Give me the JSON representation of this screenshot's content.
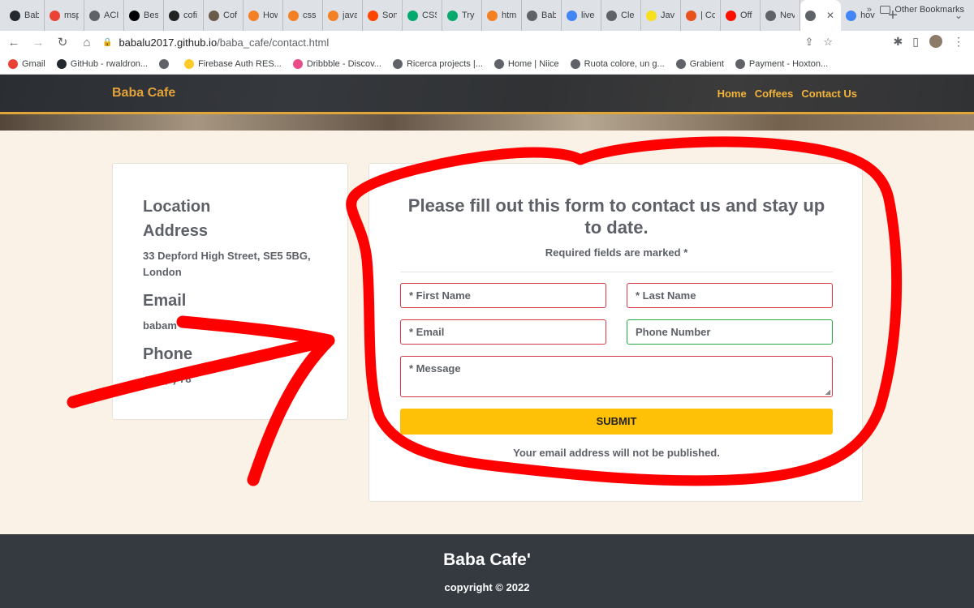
{
  "browser": {
    "tabs": [
      {
        "label": "Bab",
        "icon": "github-icon",
        "color": "#24292f"
      },
      {
        "label": "msp",
        "icon": "gmail-icon",
        "color": "#ea4335"
      },
      {
        "label": "ACI",
        "icon": "globe-icon",
        "color": "#5f6368"
      },
      {
        "label": "Bes",
        "icon": "cnet-icon",
        "color": "#000000"
      },
      {
        "label": "cofi",
        "icon": "site-icon",
        "color": "#222222"
      },
      {
        "label": "Cof",
        "icon": "cup-icon",
        "color": "#6b5b4a"
      },
      {
        "label": "How",
        "icon": "stackoverflow-icon",
        "color": "#f48024"
      },
      {
        "label": "css",
        "icon": "stackoverflow-icon",
        "color": "#f48024"
      },
      {
        "label": "java",
        "icon": "stackoverflow-icon",
        "color": "#f48024"
      },
      {
        "label": "Son",
        "icon": "reddit-icon",
        "color": "#ff4500"
      },
      {
        "label": "CSS",
        "icon": "w3schools-icon",
        "color": "#04aa6d"
      },
      {
        "label": "Try",
        "icon": "w3schools-icon",
        "color": "#04aa6d"
      },
      {
        "label": "htm",
        "icon": "stackoverflow-icon",
        "color": "#f48024"
      },
      {
        "label": "Bab",
        "icon": "globe-icon",
        "color": "#5f6368"
      },
      {
        "label": "live",
        "icon": "google-icon",
        "color": "#4285f4"
      },
      {
        "label": "Cle",
        "icon": "translate-icon",
        "color": "#5f6368"
      },
      {
        "label": "Jav",
        "icon": "js-icon",
        "color": "#f7df1e"
      },
      {
        "label": "| Co",
        "icon": "ring-icon",
        "color": "#e8531d"
      },
      {
        "label": "Off",
        "icon": "adobe-icon",
        "color": "#fa0f00"
      },
      {
        "label": "Nev",
        "icon": "chrome-icon",
        "color": "#5f6368"
      },
      {
        "label": "",
        "icon": "globe-icon",
        "color": "#5f6368",
        "active": true
      },
      {
        "label": "hov",
        "icon": "google-icon",
        "color": "#4285f4"
      }
    ],
    "url_host": "babalu2017.github.io",
    "url_path": "/baba_cafe/contact.html",
    "bookmarks": [
      {
        "label": "Gmail",
        "color": "#ea4335"
      },
      {
        "label": "GitHub - rwaldron...",
        "color": "#24292f"
      },
      {
        "label": "",
        "color": "#5f6368"
      },
      {
        "label": "Firebase Auth RES...",
        "color": "#ffca28"
      },
      {
        "label": "Dribbble - Discov...",
        "color": "#ea4c89"
      },
      {
        "label": "Ricerca projects |...",
        "color": "#5f6368"
      },
      {
        "label": "Home | Niice",
        "color": "#5f6368"
      },
      {
        "label": "Ruota colore, un g...",
        "color": "#5f6368"
      },
      {
        "label": "Grabient",
        "color": "#5f6368"
      },
      {
        "label": "Payment - Hoxton...",
        "color": "#5f6368"
      }
    ],
    "bookmarks_more": "»",
    "other_bookmarks": "Other Bookmarks"
  },
  "site": {
    "brand": "Baba Cafe",
    "nav": [
      "Home",
      "Coffees",
      "Contact Us"
    ],
    "accent": "#e3a33a"
  },
  "info": {
    "location_heading": "Location",
    "address_heading": "Address",
    "address": "33 Depford High Street, SE5 5BG, London",
    "email_heading": "Email",
    "email": "babam",
    "phone_heading": "Phone",
    "phone": "+44 (0) 78"
  },
  "form": {
    "title": "Please fill out this form to contact us and stay up to date.",
    "subtitle": "Required fields are marked *",
    "first_name": "* First Name",
    "last_name": "* Last Name",
    "email": "* Email",
    "phone": "Phone Number",
    "message": "* Message",
    "submit": "SUBMIT",
    "note": "Your email address will not be published.",
    "error_color": "#dc3545",
    "ok_color": "#28a745",
    "button_color": "#ffc107"
  },
  "footer": {
    "brand": "Baba Cafe'",
    "copyright": "copyright © 2022"
  },
  "annotation_color": "#ff0000"
}
